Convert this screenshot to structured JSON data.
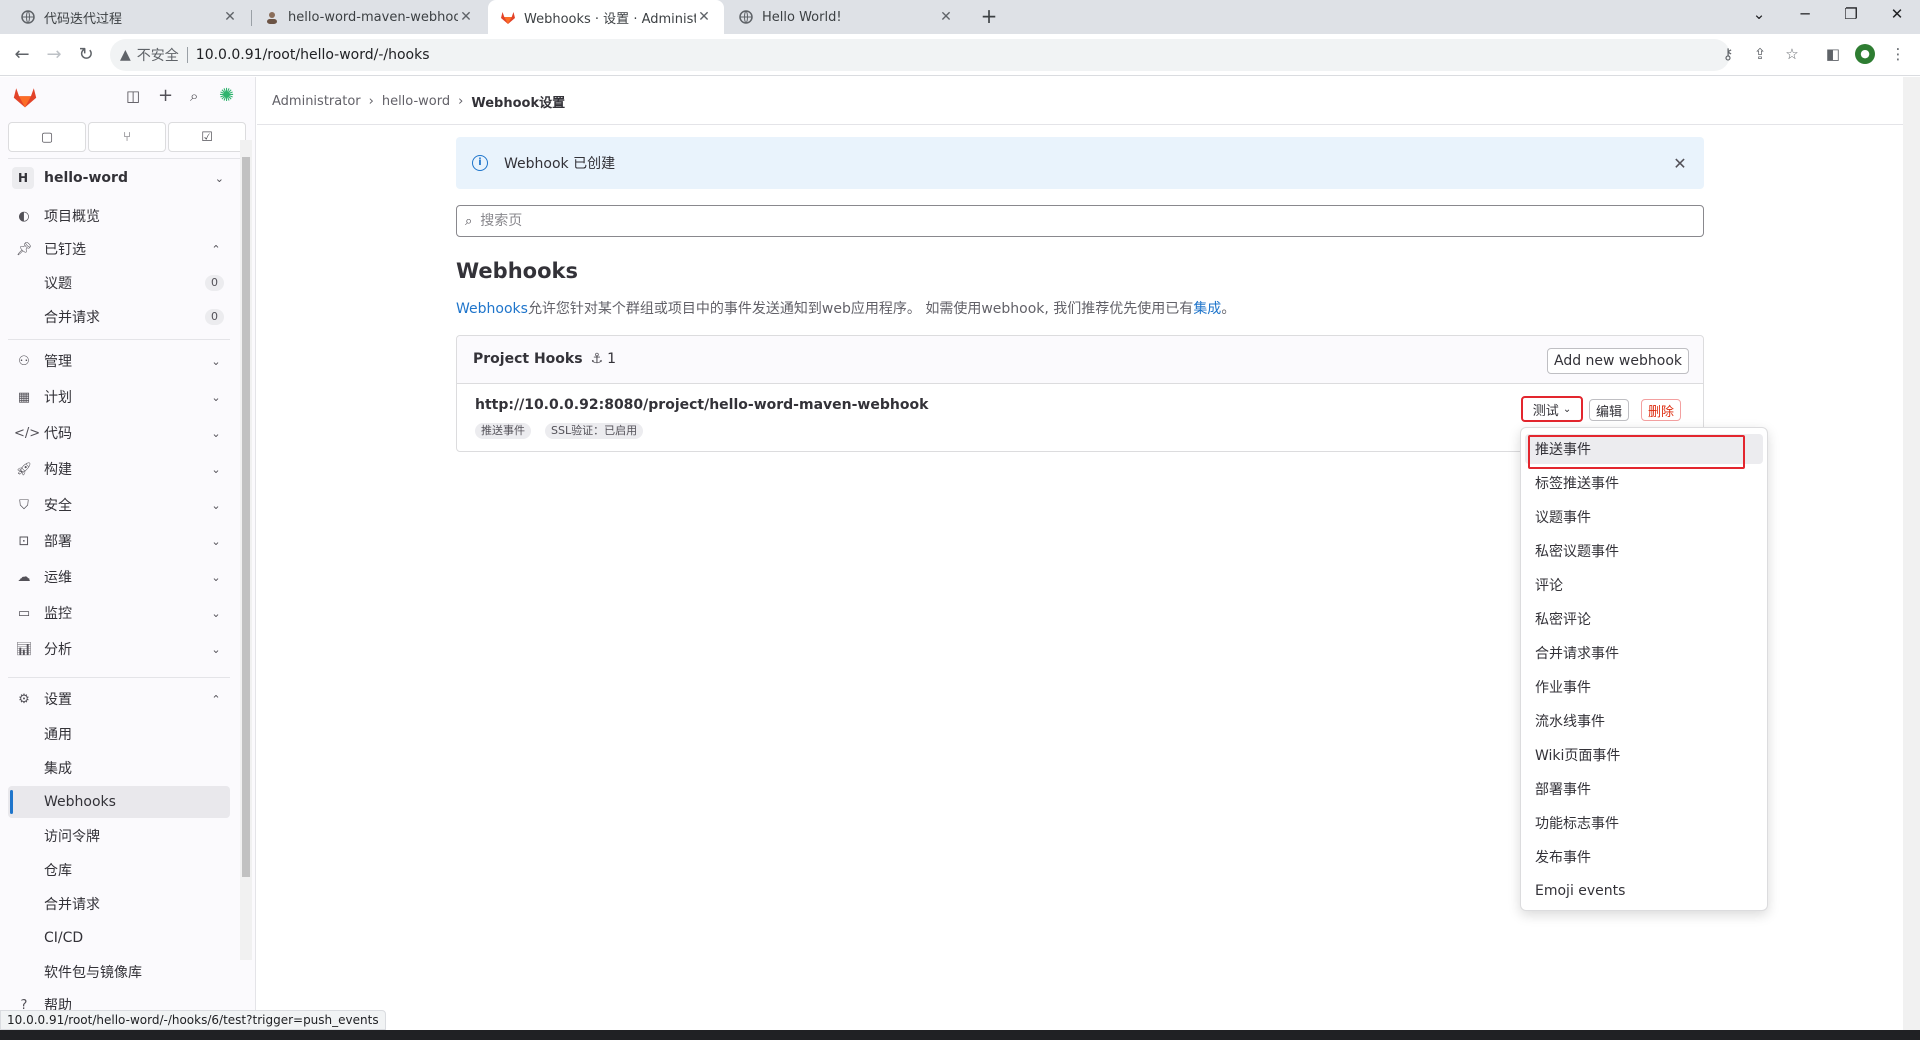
{
  "browser": {
    "tabs": [
      {
        "title": "代码迭代过程",
        "icon": "globe-icon",
        "active": false
      },
      {
        "title": "hello-word-maven-webhook [",
        "icon": "avatar-icon",
        "active": false
      },
      {
        "title": "Webhooks · 设置 · Administrat",
        "icon": "gitlab-icon",
        "active": true
      },
      {
        "title": "Hello World!",
        "icon": "globe-icon",
        "active": false
      }
    ],
    "new_tab": "+",
    "insecure_label": "不安全",
    "url": "10.0.0.91/root/hello-word/-/hooks",
    "status_url": "10.0.0.91/root/hello-word/-/hooks/6/test?trigger=push_events"
  },
  "sidebar": {
    "project_avatar": "H",
    "project_name": "hello-word",
    "items": [
      {
        "label": "项目概览",
        "icon": "overview-icon"
      },
      {
        "label": "已钉选",
        "icon": "pin-icon",
        "expanded": true
      },
      {
        "label": "管理",
        "icon": "users-icon"
      },
      {
        "label": "计划",
        "icon": "plan-icon"
      },
      {
        "label": "代码",
        "icon": "code-icon"
      },
      {
        "label": "构建",
        "icon": "rocket-icon"
      },
      {
        "label": "安全",
        "icon": "shield-icon"
      },
      {
        "label": "部署",
        "icon": "deploy-icon"
      },
      {
        "label": "运维",
        "icon": "cloud-icon"
      },
      {
        "label": "监控",
        "icon": "monitor-icon"
      },
      {
        "label": "分析",
        "icon": "chart-icon"
      },
      {
        "label": "设置",
        "icon": "gear-icon",
        "expanded": true
      }
    ],
    "pinned": [
      {
        "label": "议题",
        "count": "0"
      },
      {
        "label": "合并请求",
        "count": "0"
      }
    ],
    "settings_sub": [
      {
        "label": "通用"
      },
      {
        "label": "集成"
      },
      {
        "label": "Webhooks",
        "active": true
      },
      {
        "label": "访问令牌"
      },
      {
        "label": "仓库"
      },
      {
        "label": "合并请求"
      },
      {
        "label": "CI/CD"
      },
      {
        "label": "软件包与镜像库"
      }
    ],
    "help": "帮助"
  },
  "breadcrumb": [
    "Administrator",
    "hello-word",
    "Webhook设置"
  ],
  "alert": {
    "message": "Webhook 已创建"
  },
  "search": {
    "placeholder": "搜索页"
  },
  "page": {
    "title": "Webhooks",
    "desc_link": "Webhooks",
    "desc_text": "允许您针对某个群组或项目中的事件发送通知到web应用程序。 如需使用webhook, 我们推荐优先使用已有",
    "desc_link2": "集成",
    "desc_end": "。"
  },
  "hooks": {
    "title": "Project Hooks",
    "count": "1",
    "add_label": "Add new webhook",
    "hook": {
      "url": "http://10.0.0.92:8080/project/hello-word-maven-webhook",
      "badges": [
        "推送事件",
        "SSL验证：已启用"
      ],
      "test_label": "测试",
      "edit_label": "编辑",
      "delete_label": "删除"
    }
  },
  "dropdown": {
    "items": [
      "推送事件",
      "标签推送事件",
      "议题事件",
      "私密议题事件",
      "评论",
      "私密评论",
      "合并请求事件",
      "作业事件",
      "流水线事件",
      "Wiki页面事件",
      "部署事件",
      "功能标志事件",
      "发布事件",
      "Emoji events"
    ]
  },
  "colors": {
    "accent": "#1f75cb",
    "danger": "#dd2b0e",
    "highlight": "#e3262e",
    "gitlab_orange": "#e24329"
  }
}
